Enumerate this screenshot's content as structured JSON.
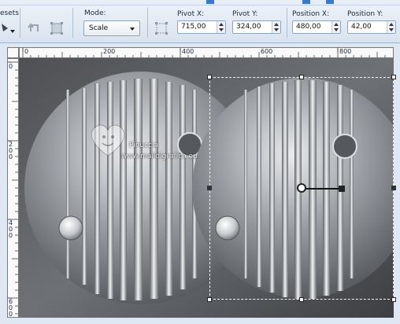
{
  "toolbar": {
    "presets_label": "esets:",
    "mode_label": "Mode:",
    "mode_value": "Scale",
    "pivot_x_label": "Pivot X:",
    "pivot_x_value": "715,00",
    "pivot_y_label": "Pivot Y:",
    "pivot_y_value": "324,00",
    "position_x_label": "Position X:",
    "position_x_value": "480,00",
    "position_y_label": "Position Y:",
    "position_y_value": "42,00"
  },
  "ruler": {
    "h_ticks": [
      "0",
      "200",
      "400",
      "600",
      "800"
    ],
    "v_ticks": [
      "0",
      "200",
      "400",
      "600"
    ]
  },
  "watermark": {
    "line1": "Pinuccia",
    "line2": "www.maildigrafica.eu"
  },
  "colors": {
    "ui_bg": "#dfe7f2",
    "selection_handle": "#1a1a1a",
    "accent_blue": "#3a78c8"
  }
}
